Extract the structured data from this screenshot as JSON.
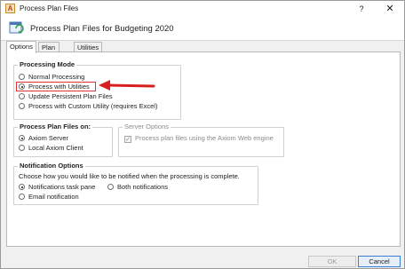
{
  "window": {
    "title": "Process Plan Files",
    "help_glyph": "?",
    "close_glyph": "✕",
    "app_icon": "A"
  },
  "header": {
    "title": "Process Plan Files for Budgeting 2020"
  },
  "tabs": [
    {
      "label": "Options",
      "active": true
    },
    {
      "label": "Plan Files",
      "active": false
    },
    {
      "label": "Utilities",
      "active": false
    }
  ],
  "processing_mode": {
    "label": "Processing Mode",
    "options": [
      {
        "label": "Normal Processing",
        "checked": false
      },
      {
        "label": "Process with Utilities",
        "checked": true
      },
      {
        "label": "Update Persistent Plan Files",
        "checked": false
      },
      {
        "label": "Process with Custom Utility (requires Excel)",
        "checked": false
      }
    ]
  },
  "process_on": {
    "label": "Process Plan Files on:",
    "options": [
      {
        "label": "Axiom Server",
        "checked": true
      },
      {
        "label": "Local Axiom Client",
        "checked": false
      }
    ]
  },
  "server_options": {
    "label": "Server Options",
    "checkbox_label": "Process plan files using the Axiom Web engine",
    "checked": true
  },
  "notification": {
    "label": "Notification Options",
    "description": "Choose how you would like to be notified when the processing is complete.",
    "options": [
      {
        "label": "Notifications task pane",
        "checked": true
      },
      {
        "label": "Both notifications",
        "checked": false
      },
      {
        "label": "Email notification",
        "checked": false
      }
    ]
  },
  "buttons": {
    "ok": "OK",
    "cancel": "Cancel"
  },
  "colors": {
    "highlight": "#e03030",
    "accent": "#3a7fd4"
  }
}
